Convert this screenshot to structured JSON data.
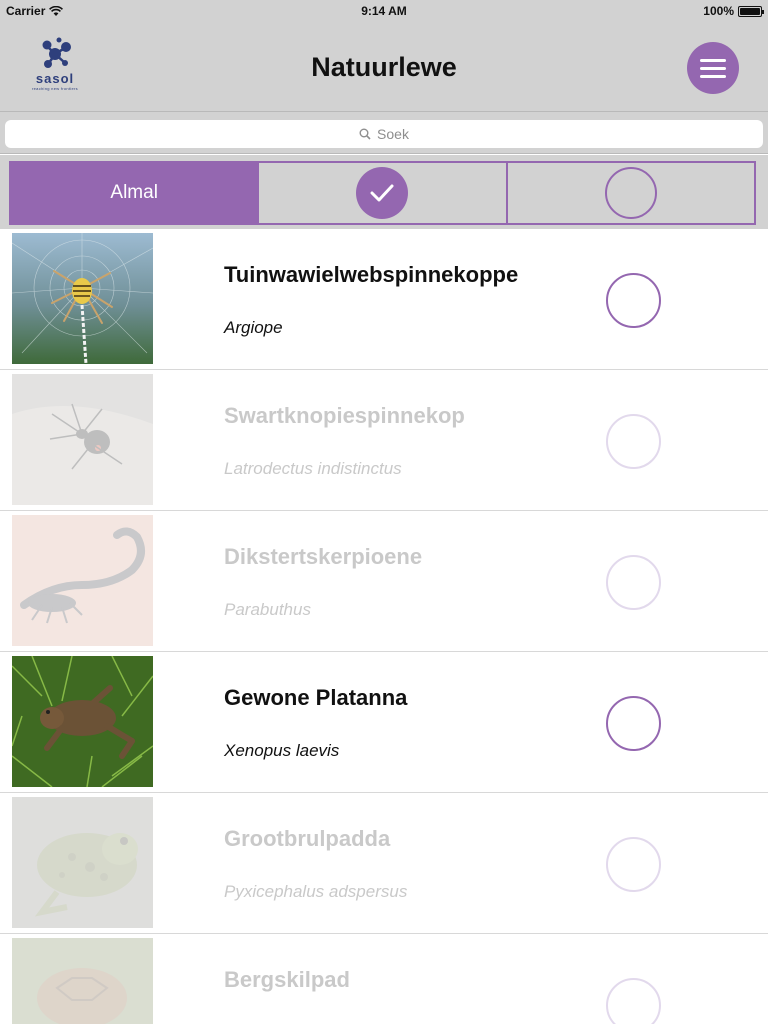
{
  "status_bar": {
    "carrier": "Carrier",
    "time": "9:14 AM",
    "battery": "100%"
  },
  "header": {
    "title": "Natuurlewe",
    "logo_text": "sasol",
    "logo_tagline": "reaching new frontiers",
    "menu_icon": "hamburger-icon"
  },
  "search": {
    "placeholder": "Soek",
    "icon": "search-icon"
  },
  "filter": {
    "all_label": "Almal",
    "selected_option": "all",
    "options": [
      "all",
      "seen",
      "not-seen"
    ]
  },
  "colors": {
    "accent": "#9467b0",
    "bar": "#d2d2d2",
    "brand": "#2e3f7c"
  },
  "species": [
    {
      "name": "Tuinwawielwebspinnekoppe",
      "latin": "Argiope",
      "seen": false,
      "highlighted": true
    },
    {
      "name": "Swartknopiespinnekop",
      "latin": "Latrodectus indistinctus",
      "seen": false,
      "highlighted": false
    },
    {
      "name": "Dikstertskerpioene",
      "latin": "Parabuthus",
      "seen": false,
      "highlighted": false
    },
    {
      "name": "Gewone Platanna",
      "latin": "Xenopus laevis",
      "seen": false,
      "highlighted": true
    },
    {
      "name": "Grootbrulpadda",
      "latin": "Pyxicephalus adspersus",
      "seen": false,
      "highlighted": false
    },
    {
      "name": "Bergskilpad",
      "latin": "",
      "seen": false,
      "highlighted": false
    }
  ]
}
